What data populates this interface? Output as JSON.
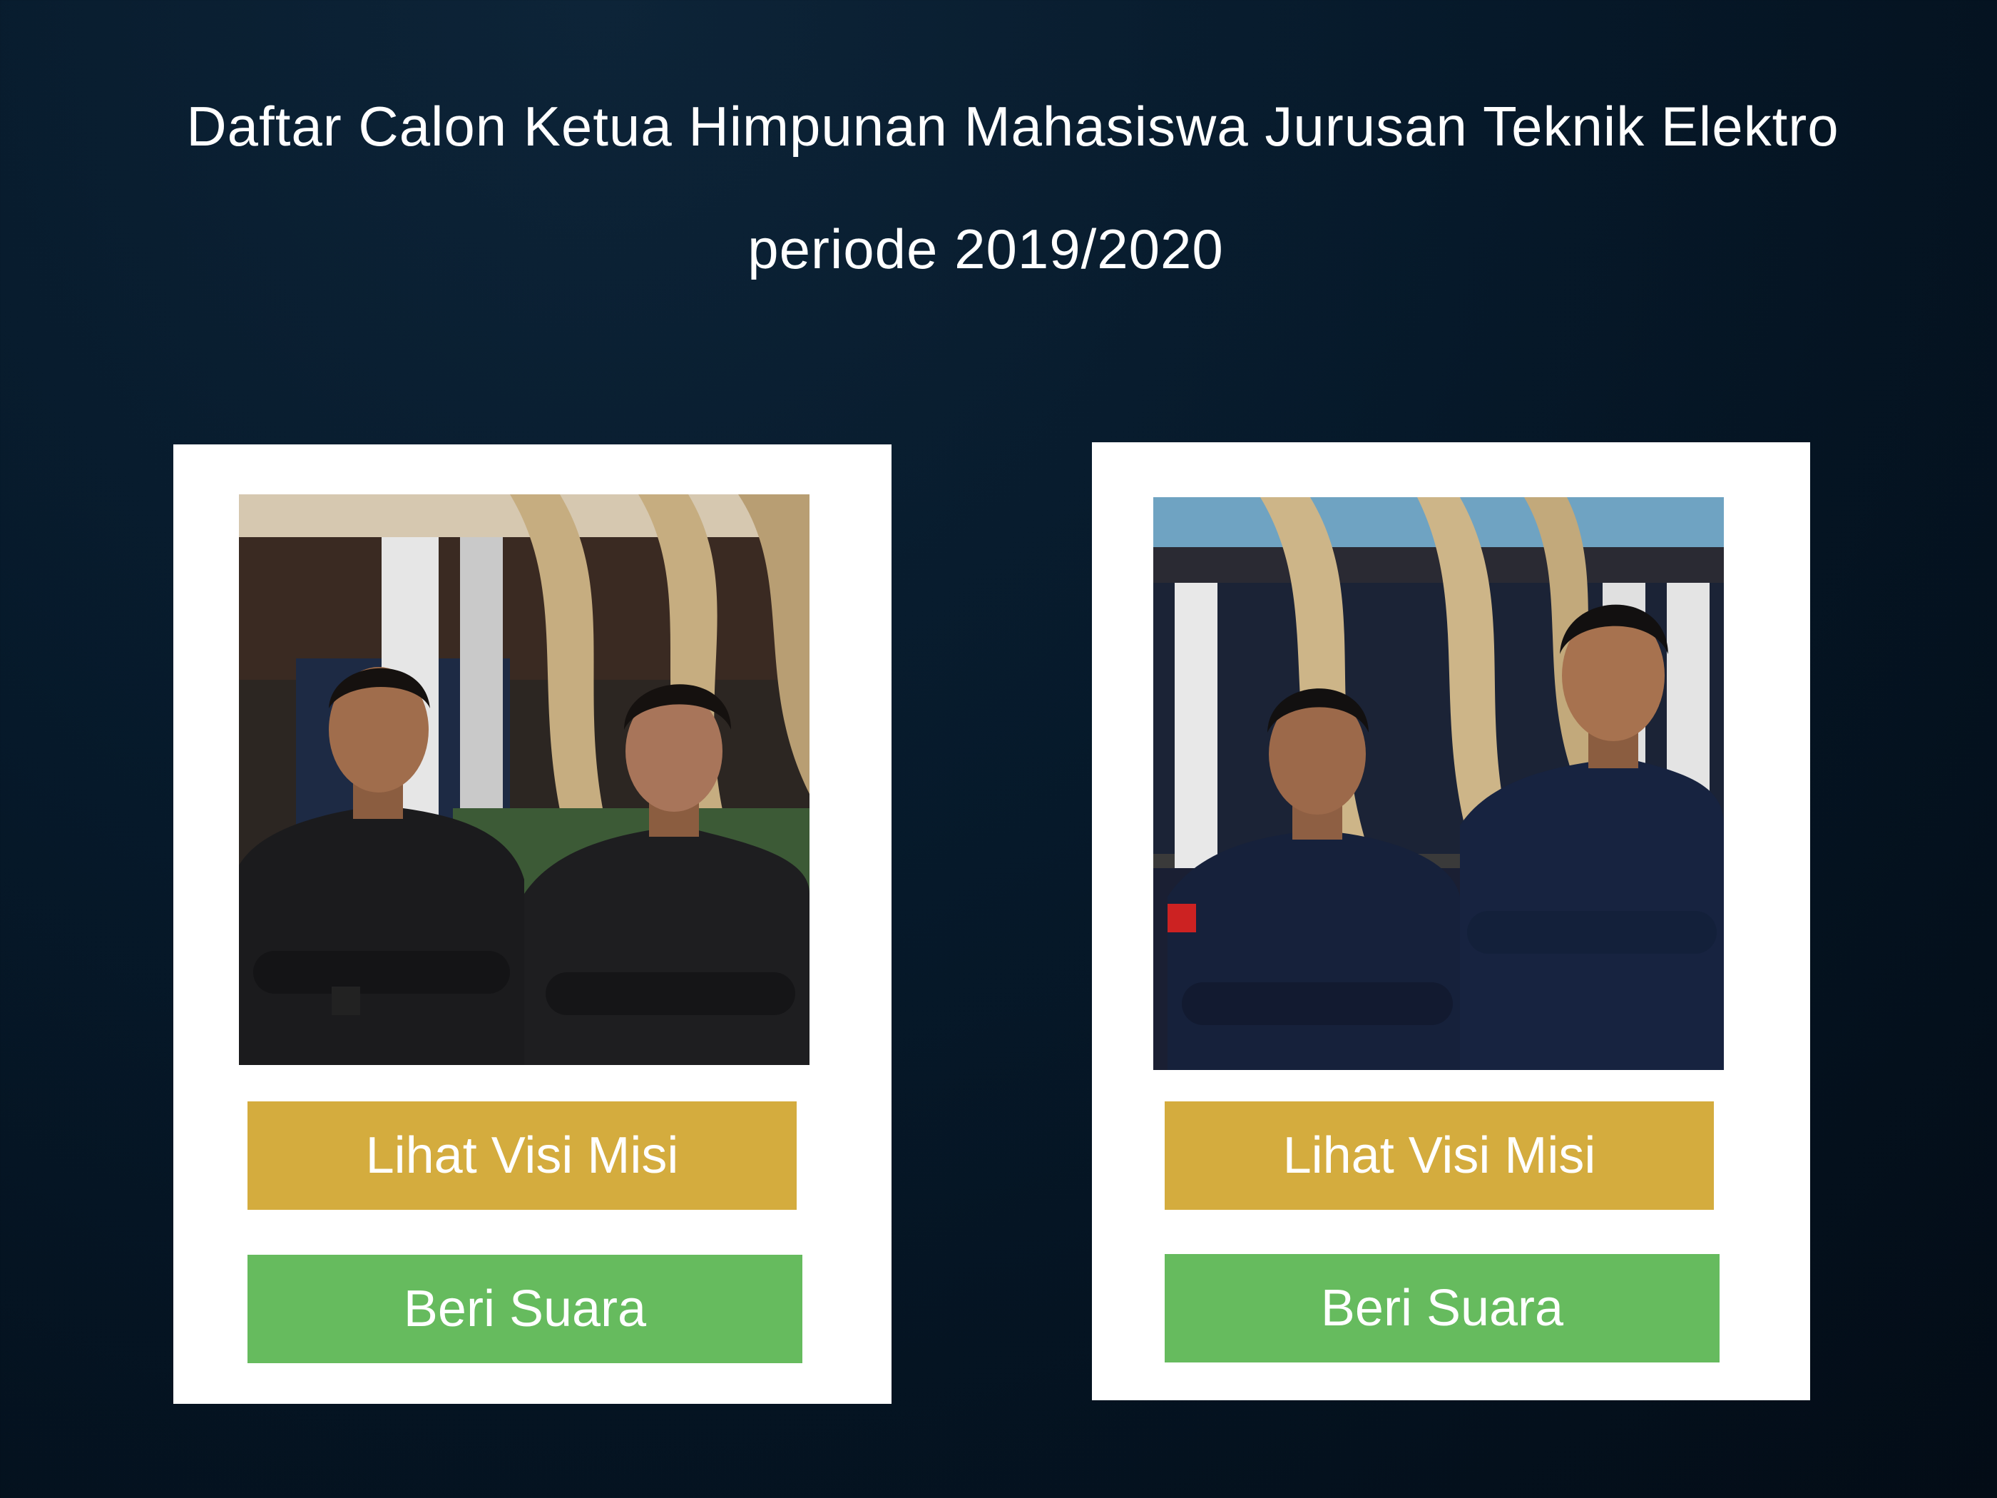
{
  "header": {
    "title_line1": "Daftar Calon Ketua Himpunan Mahasiswa Jurusan Teknik Elektro",
    "title_line2": "periode 2019/2020"
  },
  "candidates": [
    {
      "visi_button_label": "Lihat Visi Misi",
      "vote_button_label": "Beri Suara"
    },
    {
      "visi_button_label": "Lihat Visi Misi",
      "vote_button_label": "Beri Suara"
    }
  ],
  "colors": {
    "background": "#06192a",
    "card": "#ffffff",
    "visi_button": "#d4ac3e",
    "vote_button": "#66bb5e",
    "text": "#ffffff"
  }
}
